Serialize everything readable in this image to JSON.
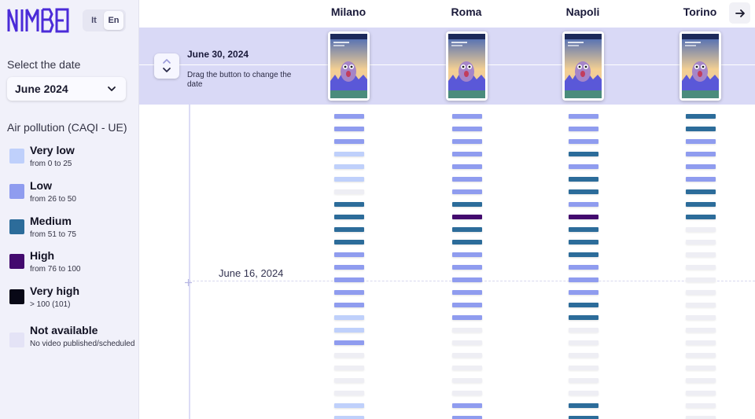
{
  "app": {
    "logo_text": "NIMBO"
  },
  "lang": {
    "it": "It",
    "en": "En",
    "active": "en"
  },
  "sidebar": {
    "select_label": "Select the date",
    "selected_month": "June 2024",
    "legend_title": "Air pollution (CAQI - UE)",
    "legend": [
      {
        "key": "very_low",
        "name": "Very low",
        "range": "from 0 to 25",
        "color": "#bfd0fb"
      },
      {
        "key": "low",
        "name": "Low",
        "range": "from 26 to 50",
        "color": "#8f9cef"
      },
      {
        "key": "medium",
        "name": "Medium",
        "range": "from 51 to 75",
        "color": "#2c6c9a"
      },
      {
        "key": "high",
        "name": "High",
        "range": "from 76 to 100",
        "color": "#430a6e"
      },
      {
        "key": "very_high",
        "name": "Very high",
        "range": "> 100 (101)",
        "color": "#080816"
      },
      {
        "key": "na",
        "name": "Not available",
        "range": "No video published/scheduled",
        "color": "#e4e3f6"
      }
    ]
  },
  "cities": [
    "Milano",
    "Roma",
    "Napoli",
    "Torino"
  ],
  "band": {
    "date": "June 30, 2024",
    "hint": "Drag the button to change the date"
  },
  "timeline": {
    "marker_date": "June 16, 2024"
  },
  "levels": {
    "Milano": [
      "low",
      "low",
      "low",
      "very_low",
      "very_low",
      "very_low",
      "na",
      "medium",
      "medium",
      "medium",
      "medium",
      "low",
      "low",
      "low",
      "low",
      "low",
      "very_low",
      "very_low",
      "low",
      "na",
      "na",
      "na",
      "na",
      "very_low",
      "very_low",
      "low"
    ],
    "Roma": [
      "low",
      "low",
      "low",
      "low",
      "low",
      "low",
      "low",
      "medium",
      "high",
      "medium",
      "medium",
      "low",
      "low",
      "low",
      "low",
      "low",
      "low",
      "na",
      "na",
      "na",
      "na",
      "na",
      "na",
      "low",
      "low",
      "low"
    ],
    "Napoli": [
      "low",
      "low",
      "low",
      "medium",
      "low",
      "medium",
      "medium",
      "low",
      "high",
      "medium",
      "medium",
      "medium",
      "low",
      "low",
      "low",
      "medium",
      "medium",
      "na",
      "na",
      "na",
      "na",
      "na",
      "na",
      "medium",
      "medium",
      "low"
    ],
    "Torino": [
      "medium",
      "medium",
      "low",
      "low",
      "low",
      "low",
      "medium",
      "medium",
      "medium",
      "na",
      "na",
      "na",
      "na",
      "na",
      "na",
      "na",
      "na",
      "na",
      "na",
      "na",
      "na",
      "na",
      "na",
      "na",
      "na",
      "na"
    ]
  },
  "icons": {
    "next": "arrow-right-icon",
    "stepper": "chevron-up-down-icon",
    "dropdown": "chevron-down-icon"
  }
}
